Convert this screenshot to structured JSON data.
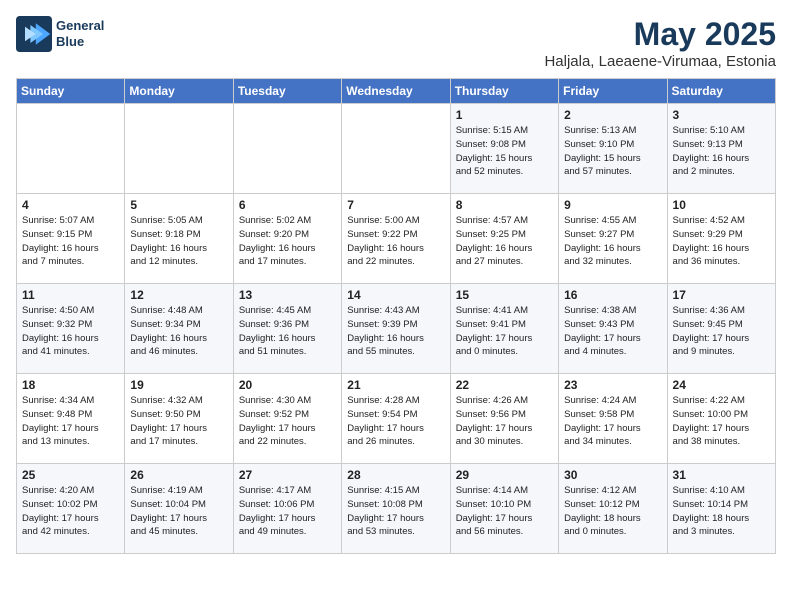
{
  "header": {
    "logo_line1": "General",
    "logo_line2": "Blue",
    "month": "May 2025",
    "location": "Haljala, Laeaene-Virumaa, Estonia"
  },
  "weekdays": [
    "Sunday",
    "Monday",
    "Tuesday",
    "Wednesday",
    "Thursday",
    "Friday",
    "Saturday"
  ],
  "weeks": [
    [
      {
        "day": "",
        "info": ""
      },
      {
        "day": "",
        "info": ""
      },
      {
        "day": "",
        "info": ""
      },
      {
        "day": "",
        "info": ""
      },
      {
        "day": "1",
        "info": "Sunrise: 5:15 AM\nSunset: 9:08 PM\nDaylight: 15 hours\nand 52 minutes."
      },
      {
        "day": "2",
        "info": "Sunrise: 5:13 AM\nSunset: 9:10 PM\nDaylight: 15 hours\nand 57 minutes."
      },
      {
        "day": "3",
        "info": "Sunrise: 5:10 AM\nSunset: 9:13 PM\nDaylight: 16 hours\nand 2 minutes."
      }
    ],
    [
      {
        "day": "4",
        "info": "Sunrise: 5:07 AM\nSunset: 9:15 PM\nDaylight: 16 hours\nand 7 minutes."
      },
      {
        "day": "5",
        "info": "Sunrise: 5:05 AM\nSunset: 9:18 PM\nDaylight: 16 hours\nand 12 minutes."
      },
      {
        "day": "6",
        "info": "Sunrise: 5:02 AM\nSunset: 9:20 PM\nDaylight: 16 hours\nand 17 minutes."
      },
      {
        "day": "7",
        "info": "Sunrise: 5:00 AM\nSunset: 9:22 PM\nDaylight: 16 hours\nand 22 minutes."
      },
      {
        "day": "8",
        "info": "Sunrise: 4:57 AM\nSunset: 9:25 PM\nDaylight: 16 hours\nand 27 minutes."
      },
      {
        "day": "9",
        "info": "Sunrise: 4:55 AM\nSunset: 9:27 PM\nDaylight: 16 hours\nand 32 minutes."
      },
      {
        "day": "10",
        "info": "Sunrise: 4:52 AM\nSunset: 9:29 PM\nDaylight: 16 hours\nand 36 minutes."
      }
    ],
    [
      {
        "day": "11",
        "info": "Sunrise: 4:50 AM\nSunset: 9:32 PM\nDaylight: 16 hours\nand 41 minutes."
      },
      {
        "day": "12",
        "info": "Sunrise: 4:48 AM\nSunset: 9:34 PM\nDaylight: 16 hours\nand 46 minutes."
      },
      {
        "day": "13",
        "info": "Sunrise: 4:45 AM\nSunset: 9:36 PM\nDaylight: 16 hours\nand 51 minutes."
      },
      {
        "day": "14",
        "info": "Sunrise: 4:43 AM\nSunset: 9:39 PM\nDaylight: 16 hours\nand 55 minutes."
      },
      {
        "day": "15",
        "info": "Sunrise: 4:41 AM\nSunset: 9:41 PM\nDaylight: 17 hours\nand 0 minutes."
      },
      {
        "day": "16",
        "info": "Sunrise: 4:38 AM\nSunset: 9:43 PM\nDaylight: 17 hours\nand 4 minutes."
      },
      {
        "day": "17",
        "info": "Sunrise: 4:36 AM\nSunset: 9:45 PM\nDaylight: 17 hours\nand 9 minutes."
      }
    ],
    [
      {
        "day": "18",
        "info": "Sunrise: 4:34 AM\nSunset: 9:48 PM\nDaylight: 17 hours\nand 13 minutes."
      },
      {
        "day": "19",
        "info": "Sunrise: 4:32 AM\nSunset: 9:50 PM\nDaylight: 17 hours\nand 17 minutes."
      },
      {
        "day": "20",
        "info": "Sunrise: 4:30 AM\nSunset: 9:52 PM\nDaylight: 17 hours\nand 22 minutes."
      },
      {
        "day": "21",
        "info": "Sunrise: 4:28 AM\nSunset: 9:54 PM\nDaylight: 17 hours\nand 26 minutes."
      },
      {
        "day": "22",
        "info": "Sunrise: 4:26 AM\nSunset: 9:56 PM\nDaylight: 17 hours\nand 30 minutes."
      },
      {
        "day": "23",
        "info": "Sunrise: 4:24 AM\nSunset: 9:58 PM\nDaylight: 17 hours\nand 34 minutes."
      },
      {
        "day": "24",
        "info": "Sunrise: 4:22 AM\nSunset: 10:00 PM\nDaylight: 17 hours\nand 38 minutes."
      }
    ],
    [
      {
        "day": "25",
        "info": "Sunrise: 4:20 AM\nSunset: 10:02 PM\nDaylight: 17 hours\nand 42 minutes."
      },
      {
        "day": "26",
        "info": "Sunrise: 4:19 AM\nSunset: 10:04 PM\nDaylight: 17 hours\nand 45 minutes."
      },
      {
        "day": "27",
        "info": "Sunrise: 4:17 AM\nSunset: 10:06 PM\nDaylight: 17 hours\nand 49 minutes."
      },
      {
        "day": "28",
        "info": "Sunrise: 4:15 AM\nSunset: 10:08 PM\nDaylight: 17 hours\nand 53 minutes."
      },
      {
        "day": "29",
        "info": "Sunrise: 4:14 AM\nSunset: 10:10 PM\nDaylight: 17 hours\nand 56 minutes."
      },
      {
        "day": "30",
        "info": "Sunrise: 4:12 AM\nSunset: 10:12 PM\nDaylight: 18 hours\nand 0 minutes."
      },
      {
        "day": "31",
        "info": "Sunrise: 4:10 AM\nSunset: 10:14 PM\nDaylight: 18 hours\nand 3 minutes."
      }
    ]
  ]
}
